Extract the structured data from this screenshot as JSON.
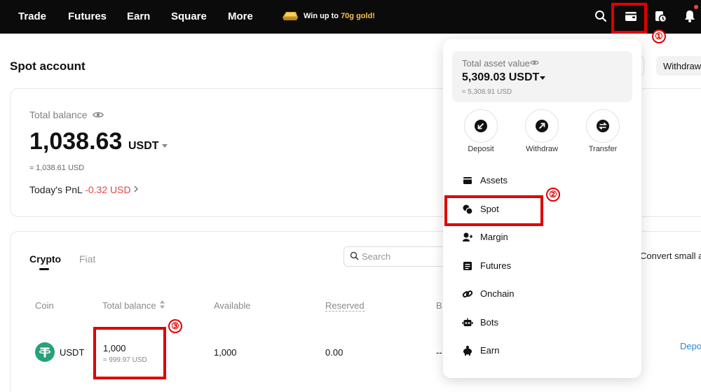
{
  "nav": {
    "items": [
      "Trade",
      "Futures",
      "Earn",
      "Square",
      "More"
    ],
    "promo_prefix": "Win up to ",
    "promo_highlight": "70g gold!",
    "icons": [
      "search-icon",
      "wallet-icon",
      "order-history-icon",
      "bell-icon"
    ]
  },
  "page": {
    "title": "Spot account",
    "withdraw_button": "Withdraw"
  },
  "balance": {
    "label": "Total balance",
    "value": "1,038.63",
    "unit": "USDT",
    "approx": "≈ 1,038.61 USD",
    "pnl_label": "Today's PnL ",
    "pnl_value": "-0.32 USD"
  },
  "holdings": {
    "tabs": [
      "Crypto",
      "Fiat"
    ],
    "search_placeholder": "Search",
    "convert_label": "Convert small a",
    "columns": [
      "Coin",
      "Total balance",
      "Available",
      "Reserved",
      "B"
    ],
    "rows": [
      {
        "coin": "USDT",
        "total": "1,000",
        "total_usd": "≈ 999.97 USD",
        "available": "1,000",
        "reserved": "0.00",
        "b": "--",
        "action": "Depo"
      }
    ]
  },
  "popup": {
    "asset_label": "Total asset value",
    "asset_value": "5,309.03 USDT",
    "asset_approx": "≈ 5,308.91 USD",
    "actions": [
      "Deposit",
      "Withdraw",
      "Transfer"
    ],
    "menu": [
      "Assets",
      "Spot",
      "Margin",
      "Futures",
      "Onchain",
      "Bots",
      "Earn"
    ]
  },
  "annotations": [
    "①",
    "②",
    "③"
  ],
  "colors": {
    "nav_bg": "#0b0b0b",
    "annotation_red": "#e00000",
    "pnl_negative": "#e04848",
    "link_blue": "#2f86d6",
    "promo_gold": "#f5c34a",
    "usdt_green": "#26a17b"
  }
}
